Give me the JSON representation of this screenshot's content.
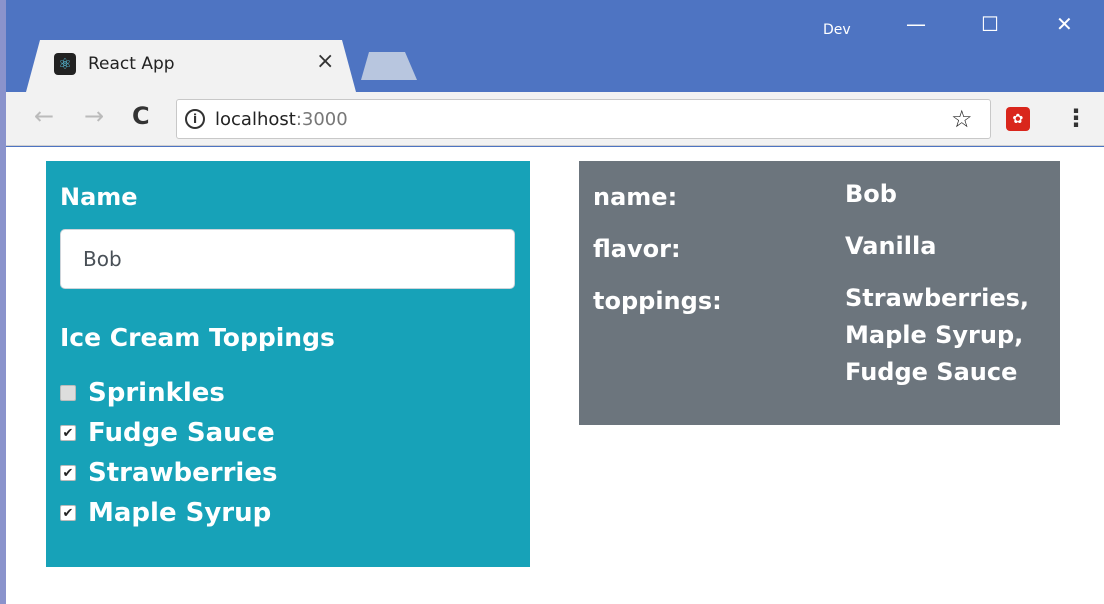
{
  "browser": {
    "tab_title": "React App",
    "tab_close": "×",
    "profile_label": "Dev",
    "window_controls": {
      "minimize": "—",
      "maximize": "☐",
      "close": "✕"
    },
    "nav": {
      "back": "←",
      "forward": "→",
      "reload": "C"
    },
    "url_host": "localhost",
    "url_port": ":3000",
    "info_icon": "i",
    "star_icon": "☆",
    "menu_icon": "⋮",
    "favicon_icon": "react-logo"
  },
  "form": {
    "name_label": "Name",
    "name_value": "Bob",
    "toppings_title": "Ice Cream Toppings",
    "toppings": [
      {
        "label": "Sprinkles",
        "checked": false
      },
      {
        "label": "Fudge Sauce",
        "checked": true
      },
      {
        "label": "Strawberries",
        "checked": true
      },
      {
        "label": "Maple Syrup",
        "checked": true
      }
    ]
  },
  "summary": {
    "rows": [
      {
        "key": "name:",
        "value": [
          "Bob"
        ]
      },
      {
        "key": "flavor:",
        "value": [
          "Vanilla"
        ]
      },
      {
        "key": "toppings:",
        "value": [
          "Strawberries,",
          "Maple Syrup,",
          "Fudge Sauce"
        ]
      }
    ]
  },
  "colors": {
    "form_panel": "#17a2b8",
    "summary_panel": "#6c757d",
    "titlebar": "#4e74c2"
  }
}
